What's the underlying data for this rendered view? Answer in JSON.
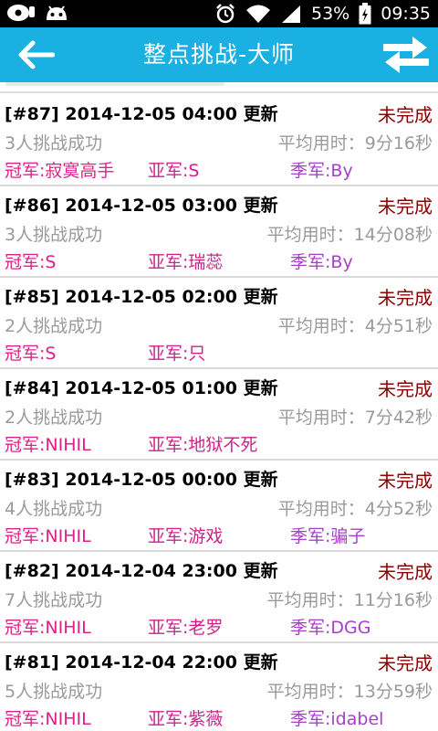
{
  "status_bar": {
    "battery": "53%",
    "time": "09:35"
  },
  "header": {
    "title": "整点挑战-大师"
  },
  "labels": {
    "gold": "冠军:",
    "silver": "亚军:",
    "bronze": "季军:",
    "avg_prefix": "平均用时："
  },
  "items": [
    {
      "header": "[#87] 2014-12-05 04:00 更新",
      "status": "未完成",
      "success": "3人挑战成功",
      "avg": "9分16秒",
      "gold": "寂寞高手",
      "silver": "S",
      "bronze": "By"
    },
    {
      "header": "[#86] 2014-12-05 03:00 更新",
      "status": "未完成",
      "success": "3人挑战成功",
      "avg": "14分08秒",
      "gold": "S",
      "silver": "瑞蕊",
      "bronze": "By"
    },
    {
      "header": "[#85] 2014-12-05 02:00 更新",
      "status": "未完成",
      "success": "2人挑战成功",
      "avg": "4分51秒",
      "gold": "S",
      "silver": "只",
      "bronze": ""
    },
    {
      "header": "[#84] 2014-12-05 01:00 更新",
      "status": "未完成",
      "success": "2人挑战成功",
      "avg": "7分42秒",
      "gold": "NIHIL",
      "silver": "地狱不死",
      "bronze": ""
    },
    {
      "header": "[#83] 2014-12-05 00:00 更新",
      "status": "未完成",
      "success": "4人挑战成功",
      "avg": "4分52秒",
      "gold": "NIHIL",
      "silver": "游戏",
      "bronze": "骗子"
    },
    {
      "header": "[#82] 2014-12-04 23:00 更新",
      "status": "未完成",
      "success": "7人挑战成功",
      "avg": "11分16秒",
      "gold": "NIHIL",
      "silver": "老罗",
      "bronze": "DGG"
    },
    {
      "header": "[#81] 2014-12-04 22:00 更新",
      "status": "未完成",
      "success": "5人挑战成功",
      "avg": "13分59秒",
      "gold": "NIHIL",
      "silver": "紫薇",
      "bronze": "idabel"
    }
  ]
}
